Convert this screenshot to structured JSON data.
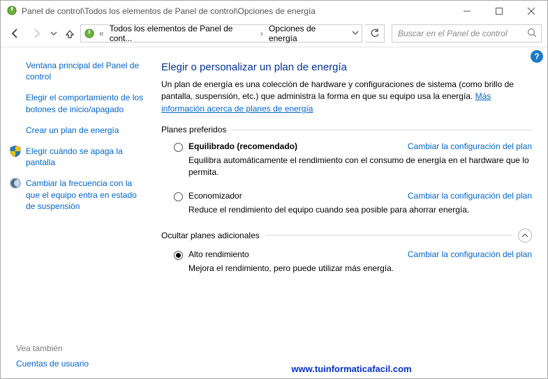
{
  "window": {
    "title": "Panel de control\\Todos los elementos de Panel de control\\Opciones de energía"
  },
  "breadcrumbs": {
    "prefix": "«",
    "item1": "Todos los elementos de Panel de cont...",
    "item2": "Opciones de energía"
  },
  "search": {
    "placeholder": "Buscar en el Panel de control"
  },
  "sidebar": {
    "home": "Ventana principal del Panel de control",
    "item1": "Elegir el comportamiento de los botones de inicio/apagado",
    "item2": "Crear un plan de energía",
    "item3": "Elegir cuándo se apaga la pantalla",
    "item4": "Cambiar la frecuencia con la que el equipo entra en estado de suspensión"
  },
  "see_also": {
    "header": "Vea también",
    "link1": "Cuentas de usuario"
  },
  "content": {
    "heading": "Elegir o personalizar un plan de energía",
    "desc_part1": "Un plan de energía es una colección de hardware y configuraciones de sistema (como brillo de pantalla, suspensión, etc.) que administra la forma en que su equipo usa la energía. ",
    "desc_link": "Más información acerca de planes de energía",
    "group1_label": "Planes preferidos",
    "group2_label": "Ocultar planes adicionales",
    "change_link": "Cambiar la configuración del plan",
    "plans": {
      "balanced": {
        "name": "Equilibrado (recomendado)",
        "desc": "Equilibra automáticamente el rendimiento con el consumo de energía en el hardware que lo permita."
      },
      "saver": {
        "name": "Economizador",
        "desc": "Reduce el rendimiento del equipo cuando sea posible para ahorrar energía."
      },
      "high": {
        "name": "Alto rendimiento",
        "desc": "Mejora el rendimiento, pero puede utilizar más energía."
      }
    }
  },
  "watermark": "www.tuinformaticafacil.com"
}
